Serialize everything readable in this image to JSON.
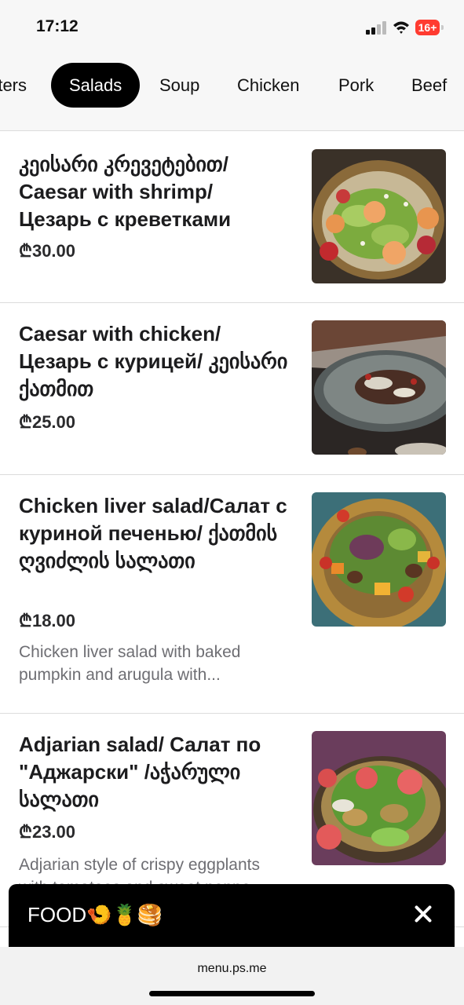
{
  "status_bar": {
    "time": "17:12",
    "battery": "16+",
    "battery_color": "#ff3b30"
  },
  "tabs": [
    {
      "label": "rters"
    },
    {
      "label": "Salads",
      "active": true
    },
    {
      "label": "Soup"
    },
    {
      "label": "Chicken"
    },
    {
      "label": "Pork"
    },
    {
      "label": "Beef"
    }
  ],
  "items": [
    {
      "title": "კეისარი კრევეტებით/ Caesar with shrimp/ Цезарь с креветками",
      "price": "₾30.00",
      "image_icon": "caesar-shrimp-photo"
    },
    {
      "title": "Caesar with chicken/ Цезарь с курицей/ კეისარი ქათმით",
      "price": "₾25.00",
      "image_icon": "caesar-chicken-photo"
    },
    {
      "title": "Chicken liver salad/Салат с куриной печенью/ ქათმის ღვიძლის სალათი",
      "price": "₾18.00",
      "description": "Chicken liver salad with baked pumpkin and arugula with...",
      "image_icon": "liver-salad-photo"
    },
    {
      "title": "Adjarian salad/ Салат по \"Аджарски\" /აჭარული სალათი",
      "price": "₾23.00",
      "description": "Adjarian style of crispy eggplants with tomatoes and sweet peppe",
      "image_icon": "adjarian-salad-photo"
    }
  ],
  "banner": {
    "label": "FOOD🍤🍍🥞",
    "close_icon": "close-icon"
  },
  "browser": {
    "url": "menu.ps.me"
  }
}
